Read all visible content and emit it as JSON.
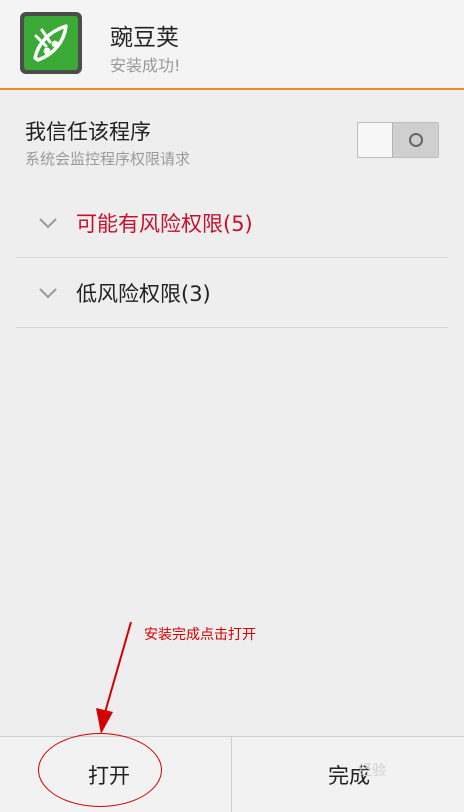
{
  "header": {
    "app_name": "豌豆荚",
    "status": "安装成功!",
    "accent_color": "#f08a24",
    "icon": "wandoujia-pea-icon"
  },
  "trust": {
    "title": "我信任该程序",
    "subtitle": "系统会监控程序权限请求",
    "toggle_state": "off"
  },
  "permissions": [
    {
      "label": "可能有风险权限(5)",
      "color": "#c8102e",
      "icon": "chevron-down-icon"
    },
    {
      "label": "低风险权限(3)",
      "color": "#222222",
      "icon": "chevron-down-icon"
    }
  ],
  "annotation": {
    "text": "安装完成点击打开",
    "color": "#d40000"
  },
  "bottom_bar": {
    "open_label": "打开",
    "done_label": "完成"
  },
  "watermark": "经验"
}
